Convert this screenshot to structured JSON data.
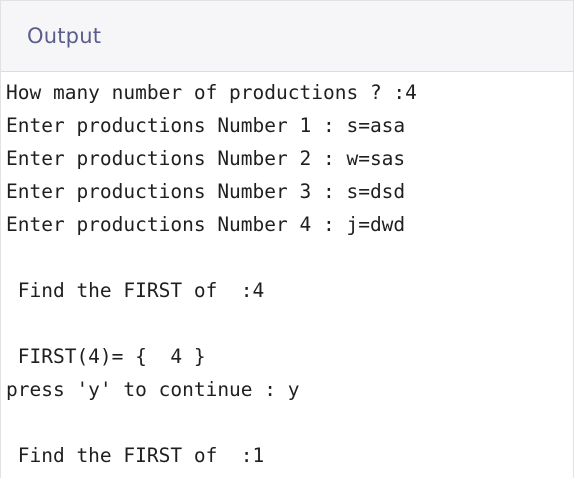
{
  "header": {
    "title": "Output"
  },
  "console": {
    "lines": [
      "How many number of productions ? :4",
      "Enter productions Number 1 : s=asa",
      "Enter productions Number 2 : w=sas",
      "Enter productions Number 3 : s=dsd",
      "Enter productions Number 4 : j=dwd",
      "",
      " Find the FIRST of  :4",
      "",
      " FIRST(4)= {  4 }",
      "press 'y' to continue : y",
      "",
      " Find the FIRST of  :1"
    ]
  },
  "colors": {
    "header_text": "#5a5d8a",
    "header_bg": "#f6f6f8",
    "console_text": "#1f1f1f"
  }
}
